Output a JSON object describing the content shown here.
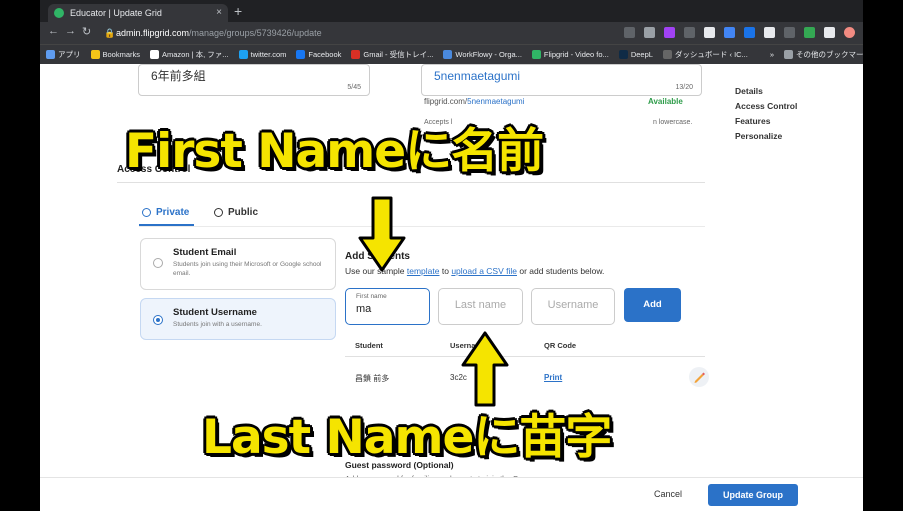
{
  "browser": {
    "tab_title": "Educator | Update Grid",
    "tab_close": "×",
    "new_tab": "+",
    "url_host": "admin.flipgrid.com",
    "url_path": "/manage/groups/5739426/update",
    "bookmarks": [
      {
        "label": "アプリ",
        "color": "#5f9cf0"
      },
      {
        "label": "Bookmarks",
        "color": "#f5c518"
      },
      {
        "label": "Amazon | 本, ファ...",
        "color": "#ffffff"
      },
      {
        "label": "twitter.com",
        "color": "#1da1f2"
      },
      {
        "label": "Facebook",
        "color": "#1877f2"
      },
      {
        "label": "Gmail - 受信トレイ...",
        "color": "#d93025"
      },
      {
        "label": "WorkFlowy - Orga...",
        "color": "#4a89dc"
      },
      {
        "label": "Flipgrid - Video fo...",
        "color": "#30b566"
      },
      {
        "label": "DeepL",
        "color": "#0f2b46"
      },
      {
        "label": "ダッシュボード ‹ IC...",
        "color": "#666666"
      },
      {
        "label": "»",
        "color": "#35363a"
      },
      {
        "label": "その他のブックマーク",
        "color": "#9aa0a6"
      }
    ]
  },
  "group": {
    "name_value": "6年前多組",
    "name_count": "5/45",
    "slug_value": "5nenmaetagumi",
    "slug_count": "13/20",
    "url_prefix": "flipgrid.com/",
    "url_slug": "5nenmaetagumi",
    "available": "Available",
    "accepts_left": "Accepts l",
    "accepts_right": "n lowercase."
  },
  "access_control": {
    "title": "Access Control",
    "tab_private": "Private",
    "tab_public": "Public",
    "options": [
      {
        "title": "Student Email",
        "desc": "Students join using their Microsoft or Google school email."
      },
      {
        "title": "Student Username",
        "desc": "Students join with a username."
      }
    ]
  },
  "add_students": {
    "title": "Add Students",
    "desc_before": "Use our sample ",
    "template_link": "template",
    "desc_middle": " to ",
    "csv_link": "upload a CSV file",
    "desc_after": " or add students below.",
    "first_name_label": "First name",
    "first_name_value": "ma",
    "last_name_placeholder": "Last name",
    "username_placeholder": "Username",
    "add_button": "Add"
  },
  "table": {
    "headers": [
      "Student",
      "Username",
      "QR Code"
    ],
    "row": {
      "student": "昌鎖 前多",
      "username": "3c2c",
      "qr": "Print"
    }
  },
  "guest": {
    "title": "Guest password (Optional)",
    "desc": "Add a password for families and guests to join the Group."
  },
  "side_nav": [
    "Details",
    "Access Control",
    "Features",
    "Personalize"
  ],
  "footer": {
    "cancel": "Cancel",
    "update": "Update Group"
  },
  "overlay": {
    "top_caption": "First Nameに名前",
    "bottom_caption": "Last Nameに苗字"
  },
  "colors": {
    "accent": "#2b72c8",
    "caption": "#f5e400"
  }
}
